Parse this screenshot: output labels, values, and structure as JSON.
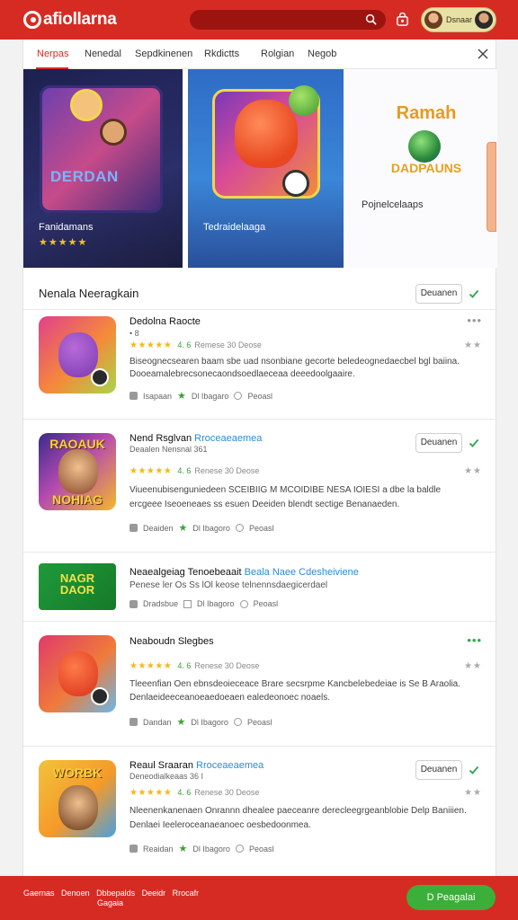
{
  "header": {
    "logo_text": "afiollarna",
    "user_name": "Dsnaar",
    "accent": "#d62b23"
  },
  "tabs": [
    {
      "label": "Nerpas",
      "active": true
    },
    {
      "label": "Nenedal",
      "active": false
    },
    {
      "label": "Sepdkinenen",
      "active": false
    },
    {
      "label": "Rkdictts",
      "active": false
    },
    {
      "label": "Rolgian",
      "active": false
    },
    {
      "label": "Negob",
      "active": false
    }
  ],
  "banner": [
    {
      "art_text": "DERDAN",
      "caption": "Fanidamans",
      "stars": "★★★★★"
    },
    {
      "caption": "Tedraidelaaga"
    },
    {
      "logo_top": "Ramah",
      "logo_bottom": "DADPAUNS",
      "caption": "Pojnelcelaaps"
    }
  ],
  "section": {
    "title": "Nenala Neeragkain",
    "button": "Deuanen"
  },
  "items": [
    {
      "name": "Dedolna Raocte",
      "sub": "• 8",
      "stars": "★★★★★",
      "rating_green": "4. 6",
      "rating_rest": "Remese 30 Deose",
      "desc1": "Biseognecsearen baam sbe uad nsonbiane gecorte beledeognedaecbel bgl baiina.",
      "desc2": "Dooeamalebrecsonecaondsoedlaeceaa deeedoolgaaire.",
      "meta": [
        "Isapaan",
        "Dl Ibagaro",
        "Peoasl"
      ]
    },
    {
      "name": "Nend Rsglvan",
      "name_hl": "Rroceaeaemea",
      "sub": "Deaalen Nensnal 361",
      "button": "Deuanen",
      "art_top": "RAOAUK",
      "art_bottom": "NOHIAG",
      "stars": "★★★★★",
      "rating_green": "4. 6",
      "rating_rest": "Renese 30 Deose",
      "desc1": "Viueenubisenguniedeen SCEIBIIG M MCOIDIBE NESA IOIESI a dbe la baldle",
      "desc2": "ercgeee Iseoeneaes ss esuen Deeiden blendt sectige Benanaeden.",
      "meta": [
        "Deaiden",
        "Dl Ibagoro",
        "Peoasl"
      ]
    },
    {
      "name": "Neaealgeiag Tenoebeaait",
      "name_hl": "Beala Naee Cdesheiviene",
      "art_top": "NAGR",
      "art_bottom": "DAOR",
      "desc1": "Penese ler Os Ss lOl keose telnennsdaegicerdael",
      "meta": [
        "Dradsbue",
        "Dl Ibagoro",
        "Peoasl"
      ]
    },
    {
      "name": "Neaboudn Slegbes",
      "stars": "★★★★★",
      "rating_green": "4. 6",
      "rating_rest": "Renese 30 Deose",
      "desc1": "Tleeenfian Oen ebnsdeoieceace Brare secsrpme Kancbelebedeiae is Se B Araolia.",
      "desc2": "Denlaeideeceanoeaedoeaen ealedeonoec noaels.",
      "meta": [
        "Dandan",
        "Dl Ibagoro",
        "Peoasl"
      ]
    },
    {
      "name": "Reaul Sraaran",
      "name_hl": "Rroceaeaemea",
      "sub": "Deneodialkeaas 36 I",
      "button": "Deuanen",
      "art_top": "WORBK",
      "stars": "★★★★★",
      "rating_green": "4. 6",
      "rating_rest": "Renese 30 Deose",
      "desc1": "Nleenenkanenaen Onrannn dhealee paeceanre derecleegrgeanblobie Delp Baniiien.",
      "desc2": "Denlaei Ieeleroceanaeanoec oesbedoonmea.",
      "meta": [
        "Reaidan",
        "Dl Ibagoro",
        "Peoasl"
      ]
    }
  ],
  "footer": {
    "links": [
      "Gaernas",
      "Denoen",
      "Dbbepalds",
      "Deeidr",
      "Rrocafr",
      "Gagaia"
    ],
    "cta": "D Peagalai"
  }
}
